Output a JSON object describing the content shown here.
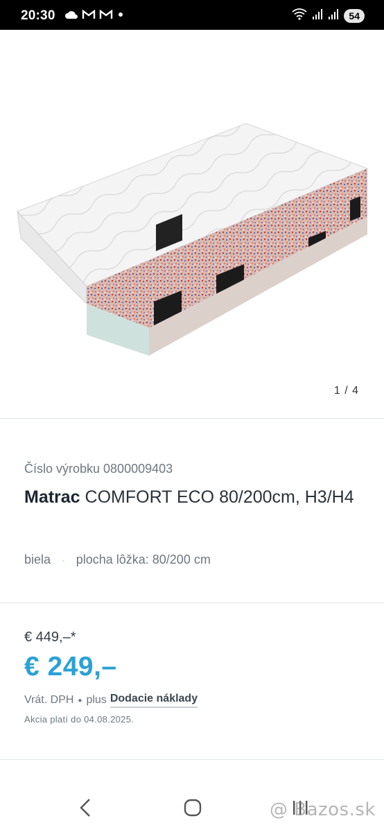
{
  "status_bar": {
    "time": "20:30",
    "notification_icons": [
      "cloud-icon",
      "gmail-icon",
      "gmail-icon",
      "dot-icon"
    ],
    "right_icons": [
      "wifi-icon",
      "signal-icon",
      "signal-icon"
    ],
    "battery": "54"
  },
  "gallery": {
    "counter": "1 / 4",
    "image_alt": "mattress-image"
  },
  "product": {
    "sku": "Číslo výrobku 0800009403",
    "brand": "Matrac",
    "name": " COMFORT ECO 80/200cm, H3/H4",
    "color": "biela",
    "bed_area": "plocha lôžka: 80/200 cm"
  },
  "pricing": {
    "old_price": "€ 449,–*",
    "price": "€ 249,–",
    "vat": "Vrát. DPH",
    "plus": "plus",
    "shipping_link": "Dodacie náklady",
    "promo_note": "Akcia platí do 04.08.2025."
  },
  "nav": {
    "back_icon": "back-icon",
    "home_icon": "home-icon",
    "recents_icon": "recents-icon",
    "watermark": "@ Bazos.sk"
  },
  "colors": {
    "accent": "#2aa1d6",
    "status_bg": "#000000"
  }
}
